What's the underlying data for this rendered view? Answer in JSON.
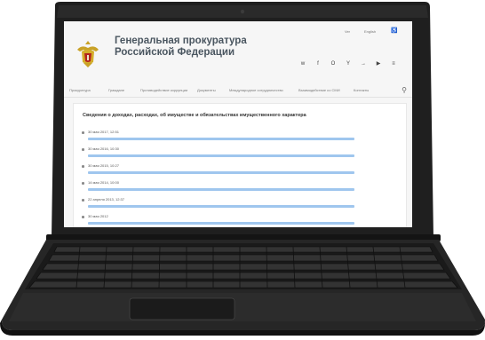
{
  "screen": {
    "topbar": {
      "contrast_label": "Ver",
      "lang_label": "English"
    },
    "site_title_line1": "Генеральная прокуратура",
    "site_title_line2": "Российской Федерации",
    "social_icons": [
      "vk-icon",
      "facebook-icon",
      "odnoklassniki-icon",
      "telegram-icon",
      "twitter-icon",
      "youtube-icon",
      "rss-icon"
    ],
    "social_glyphs": [
      "w",
      "f",
      "O",
      "Y",
      "→",
      "▶",
      "≡"
    ],
    "nav_items": [
      "Прокуратура",
      "Граждане",
      "Противодействие коррупции",
      "Документы",
      "Международное сотрудничество",
      "Взаимодействие со СМИ",
      "Контакты"
    ],
    "content_title": "Сведения о доходах, расходах, об имуществе и обязательствах имущественного характера",
    "entries": [
      {
        "date": "30 мая 2017, 12:51"
      },
      {
        "date": "30 мая 2016, 10:30"
      },
      {
        "date": "30 мая 2015, 10:27"
      },
      {
        "date": "14 мая 2014, 10:00"
      },
      {
        "date": "22 апреля 2013, 12:37"
      },
      {
        "date": "30 мая 2012"
      }
    ]
  },
  "colors": {
    "body_black": "#232323",
    "screen_bg": "#f6f6f6",
    "link_blue": "#9fc6ee",
    "title_gray": "#4a5660"
  }
}
